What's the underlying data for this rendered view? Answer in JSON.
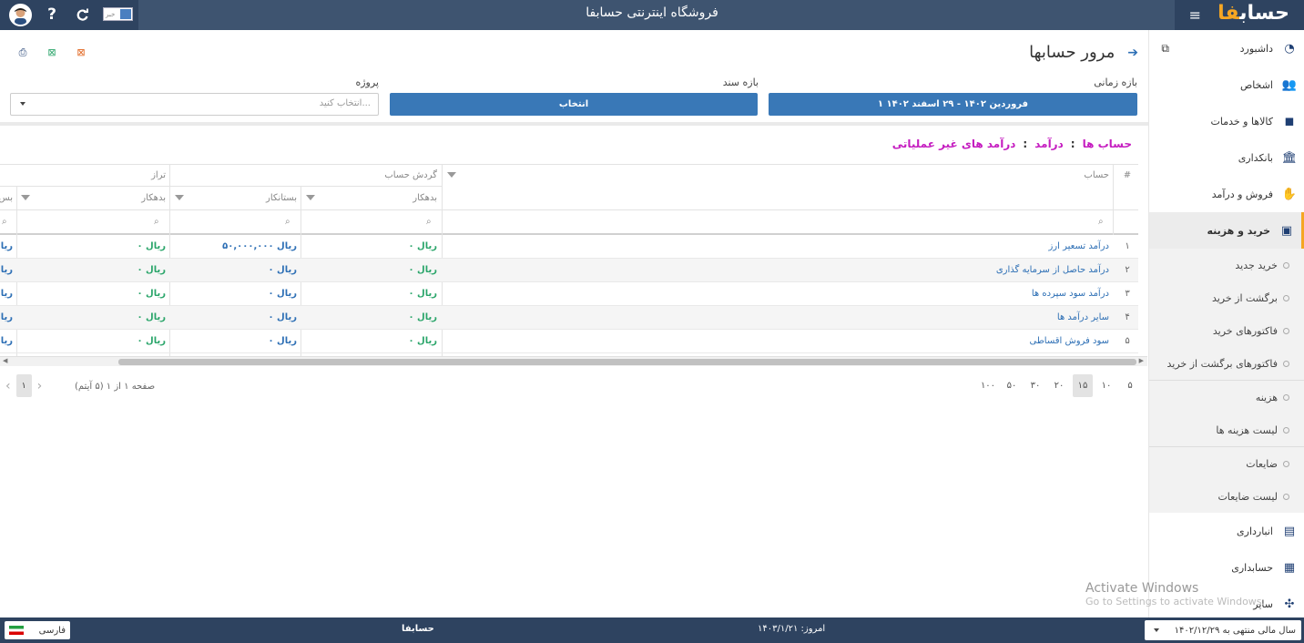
{
  "topbar": {
    "title": "فروشگاه اینترنتی حسابفا",
    "news_label": "خبر",
    "help_icon": "?",
    "menu_icon": "≡",
    "brand_prefix": "حساب",
    "brand_suffix": "فا"
  },
  "page": {
    "title": "مرور حسابها",
    "filter_period_label": "بازه زمانی",
    "filter_period_value": "۱ فروردین ۱۴۰۲ - ۲۹ اسفند ۱۴۰۲",
    "filter_doc_label": "بازه سند",
    "filter_doc_value": "انتخاب",
    "filter_project_label": "پروژه",
    "filter_project_placeholder": "انتخاب کنید..."
  },
  "breadcrumb": {
    "items": [
      "حساب ها",
      "درآمد",
      "درآمد های غیر عملیاتی"
    ],
    "separator": ":"
  },
  "sidebar": {
    "items": [
      {
        "label": "داشبورد",
        "icon": "dashboard-icon"
      },
      {
        "label": "اشخاص",
        "icon": "people-icon"
      },
      {
        "label": "کالاها و خدمات",
        "icon": "box-icon"
      },
      {
        "label": "بانکداری",
        "icon": "bank-icon"
      },
      {
        "label": "فروش و درآمد",
        "icon": "sales-icon"
      },
      {
        "label": "خرید و هزینه",
        "icon": "wallet-icon"
      }
    ],
    "subitems": [
      "خرید جدید",
      "برگشت از خرید",
      "فاکتورهای خرید",
      "فاکتورهای برگشت از خرید",
      "هزینه",
      "لیست هزینه ها",
      "ضایعات",
      "لیست ضایعات"
    ],
    "bottom_items": [
      {
        "label": "انبارداری",
        "icon": "warehouse-icon"
      },
      {
        "label": "حسابداری",
        "icon": "ledger-icon"
      },
      {
        "label": "سایر",
        "icon": "misc-icon"
      }
    ]
  },
  "table": {
    "headers": {
      "num": "#",
      "account": "حساب",
      "turnover_group": "گردش حساب",
      "balance_group": "تراز",
      "debit": "بدهکار",
      "credit": "بستانکار",
      "balance_debit": "بدهکار",
      "balance_credit_partial": "بس"
    },
    "rows": [
      {
        "num": "۱",
        "account": "درآمد تسعیر ارز",
        "debit": "۰ ریال",
        "credit": "۵۰,۰۰۰,۰۰۰ ریال",
        "bal_debit": "۰ ریال",
        "bal_credit": "ریال"
      },
      {
        "num": "۲",
        "account": "درآمد حاصل از سرمایه گذاری",
        "debit": "۰ ریال",
        "credit": "۰ ریال",
        "bal_debit": "۰ ریال",
        "bal_credit": "ریال"
      },
      {
        "num": "۳",
        "account": "درآمد سود سپرده ها",
        "debit": "۰ ریال",
        "credit": "۰ ریال",
        "bal_debit": "۰ ریال",
        "bal_credit": "ریال"
      },
      {
        "num": "۴",
        "account": "سایر درآمد ها",
        "debit": "۰ ریال",
        "credit": "۰ ریال",
        "bal_debit": "۰ ریال",
        "bal_credit": "ریال"
      },
      {
        "num": "۵",
        "account": "سود فروش اقساطی",
        "debit": "۰ ریال",
        "credit": "۰ ریال",
        "bal_debit": "۰ ریال",
        "bal_credit": "ریال"
      }
    ]
  },
  "pager": {
    "sizes": [
      "۵",
      "۱۰",
      "۱۵",
      "۲۰",
      "۳۰",
      "۵۰",
      "۱۰۰"
    ],
    "selected": "۱۵",
    "info": "صفحه ۱ از ۱ (۵ آیتم)",
    "current_page": "۱"
  },
  "watermark": {
    "line1": "Activate Windows",
    "line2": "Go to Settings to activate Windows."
  },
  "footer": {
    "language": "فارسی",
    "app_name": "حسابفا",
    "today": "امروز: ۱۴۰۳/۱/۲۱",
    "fiscal_year": "سال مالی منتهی به ۱۴۰۲/۱۲/۲۹"
  },
  "colors": {
    "topbar": "#3e5470",
    "primary_button": "#3978b7",
    "breadcrumb": "#c51dc0",
    "amount_green": "#2aa56a",
    "link_blue": "#2d6fb5",
    "active_marker": "#f5a623"
  }
}
